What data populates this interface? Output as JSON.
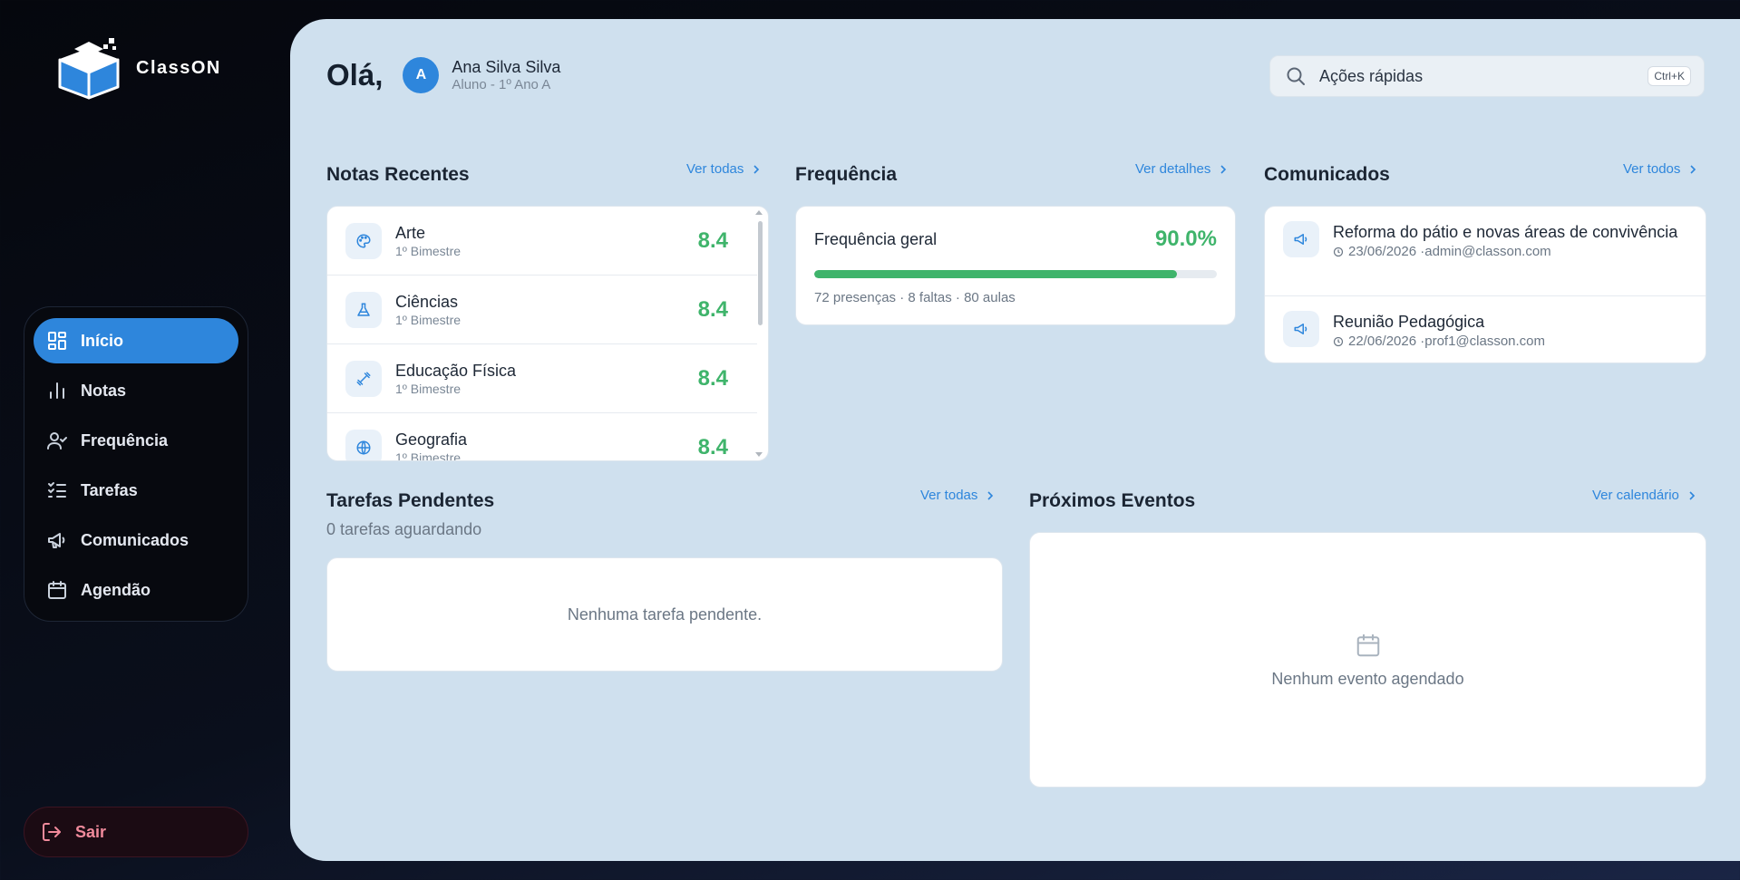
{
  "app": {
    "name": "ClassON"
  },
  "sidebar": {
    "items": [
      {
        "label": "Início",
        "icon": "dashboard-icon",
        "active": true
      },
      {
        "label": "Notas",
        "icon": "bar-chart-icon",
        "active": false
      },
      {
        "label": "Frequência",
        "icon": "user-check-icon",
        "active": false
      },
      {
        "label": "Tarefas",
        "icon": "checklist-icon",
        "active": false
      },
      {
        "label": "Comunicados",
        "icon": "megaphone-icon",
        "active": false
      },
      {
        "label": "Agendão",
        "icon": "calendar-icon",
        "active": false
      }
    ],
    "logout_label": "Sair"
  },
  "header": {
    "greeting": "Olá,",
    "avatar_initial": "A",
    "user_name": "Ana Silva Silva",
    "user_role": "Aluno - 1º Ano A",
    "search_placeholder": "Ações rápidas",
    "search_shortcut": "Ctrl+K"
  },
  "grades": {
    "title": "Notas Recentes",
    "link": "Ver todas",
    "items": [
      {
        "subject": "Arte",
        "term": "1º Bimestre",
        "value": "8.4",
        "icon": "palette-icon"
      },
      {
        "subject": "Ciências",
        "term": "1º Bimestre",
        "value": "8.4",
        "icon": "flask-icon"
      },
      {
        "subject": "Educação Física",
        "term": "1º Bimestre",
        "value": "8.4",
        "icon": "dumbbell-icon"
      },
      {
        "subject": "Geografia",
        "term": "1º Bimestre",
        "value": "8.4",
        "icon": "globe-icon"
      }
    ]
  },
  "attendance": {
    "title": "Frequência",
    "link": "Ver detalhes",
    "label": "Frequência geral",
    "value": "90.0%",
    "fill_fraction": 0.9,
    "detail": "72 presenças · 8 faltas · 80 aulas"
  },
  "notices": {
    "title": "Comunicados",
    "link": "Ver todos",
    "items": [
      {
        "title": "Reforma do pátio e novas áreas de convivência",
        "meta": "23/06/2026 ·admin@classon.com"
      },
      {
        "title": "Reunião Pedagógica",
        "meta": "22/06/2026 ·prof1@classon.com"
      }
    ]
  },
  "tasks": {
    "title": "Tarefas Pendentes",
    "subtitle": "0 tarefas aguardando",
    "link": "Ver todas",
    "empty": "Nenhuma tarefa pendente."
  },
  "events": {
    "title": "Próximos Eventos",
    "link": "Ver calendário",
    "empty": "Nenhum evento agendado"
  },
  "colors": {
    "accent": "#2e86dc",
    "success": "#3fb46b",
    "danger": "#f08a9b",
    "panel": "#cfe0ee"
  }
}
